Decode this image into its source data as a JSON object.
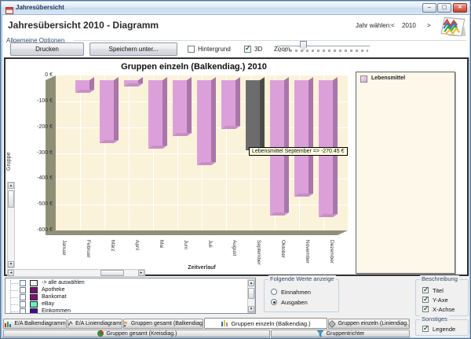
{
  "window": {
    "title": "Jahresübersicht",
    "controls": {
      "minimize": "–",
      "maximize": "▢",
      "close": "✕"
    }
  },
  "header": {
    "title": "Jahresübersicht 2010 - Diagramm",
    "year_chooser": {
      "label": "Jahr wählen:",
      "prev": "<",
      "year": "2010",
      "next": ">"
    }
  },
  "options": {
    "group_label": "Allgemeine Optionen",
    "print_button": "Drucken",
    "save_button": "Speichern unter...",
    "background_checkbox": {
      "label": "Hintergrund",
      "checked": false
    },
    "threed_checkbox": {
      "label": "3D",
      "checked": true
    },
    "zoom": {
      "label": "Zoom",
      "position": 0.28
    }
  },
  "chart_data": {
    "type": "bar",
    "title": "Gruppen einzeln (Balkendiag.) 2010",
    "xlabel": "Zeitverlauf",
    "ylabel": "Gruppe",
    "categories": [
      "Januar",
      "Februar",
      "März",
      "April",
      "Mai",
      "Juni",
      "Juli",
      "August",
      "September",
      "Oktober",
      "November",
      "Dezember"
    ],
    "series": [
      {
        "name": "Lebensmittel",
        "values": [
          0,
          -50,
          -245,
          -25,
          -265,
          -215,
          -330,
          -190,
          -270.45,
          -525,
          -450,
          -530
        ]
      }
    ],
    "ylim": [
      -600,
      0
    ],
    "yticks": [
      "0 €",
      "-100 €",
      "-200 €",
      "-300 €",
      "-400 €",
      "-500 €",
      "-600 €"
    ],
    "grid": true,
    "legend_position": "right",
    "highlighted_index": 8,
    "tooltip": "Lebensmittel September => -270.45 €",
    "colors": {
      "bar_front": "#DBA0DA",
      "bar_side": "#A876A8",
      "bar_bottom": "#C78FC6",
      "highlight_front": "#6C6C6C",
      "highlight_side": "#4B4B4B",
      "highlight_bottom": "#5C5C5C",
      "plot_bg": "#FBF2DA",
      "wall": "#8F8F78",
      "grid": "#FFFFFF",
      "legend_bg": "#FDF8EA"
    }
  },
  "legend": {
    "items": [
      {
        "label": "Lebensmittel",
        "color": "#DBA0DA"
      }
    ]
  },
  "filter_list": {
    "items": [
      {
        "label": "-> alle auswählen",
        "color": "#F2F2F2",
        "checked": false
      },
      {
        "label": "Apotheke",
        "color": "#750F75",
        "checked": false
      },
      {
        "label": "Bankomat",
        "color": "#7D1080",
        "checked": false
      },
      {
        "label": "eBay",
        "color": "#63F2C4",
        "checked": false
      },
      {
        "label": "Einkommen",
        "color": "#3C0E96",
        "checked": false
      }
    ]
  },
  "value_selector": {
    "label": "Folgende Werte anzeige",
    "options": [
      {
        "label": "Einnahmen",
        "selected": false
      },
      {
        "label": "Ausgaben",
        "selected": true
      }
    ]
  },
  "beschreibung": {
    "label": "Beschreibung",
    "items": [
      {
        "label": "Titel",
        "checked": true
      },
      {
        "label": "Y-Axe",
        "checked": true
      },
      {
        "label": "X-Achse",
        "checked": true
      }
    ]
  },
  "sonstiges": {
    "label": "Sonstiges",
    "items": [
      {
        "label": "Legende",
        "checked": true
      }
    ]
  },
  "tabs": {
    "row1": [
      {
        "label": "E/A Balkendiagramm",
        "icon": "bar-chart-icon",
        "active": false
      },
      {
        "label": "E/A Liniendiagramm",
        "icon": "line-chart-icon",
        "active": false
      },
      {
        "label": "Gruppen gesamt (Balkendiag.)",
        "icon": "hbar-chart-icon",
        "active": false
      },
      {
        "label": "Gruppen einzeln (Balkendiag.)",
        "icon": "column-chart-icon",
        "active": true
      },
      {
        "label": "Gruppen einzeln (Liniendiag.)",
        "icon": "gear-icon",
        "active": false
      }
    ],
    "row2": [
      {
        "label": "Gruppen gesamt (Kreisdiag.)",
        "icon": "pie-chart-icon",
        "active": false
      },
      {
        "label": "Gruppentrichter",
        "icon": "funnel-icon",
        "active": false
      }
    ]
  }
}
